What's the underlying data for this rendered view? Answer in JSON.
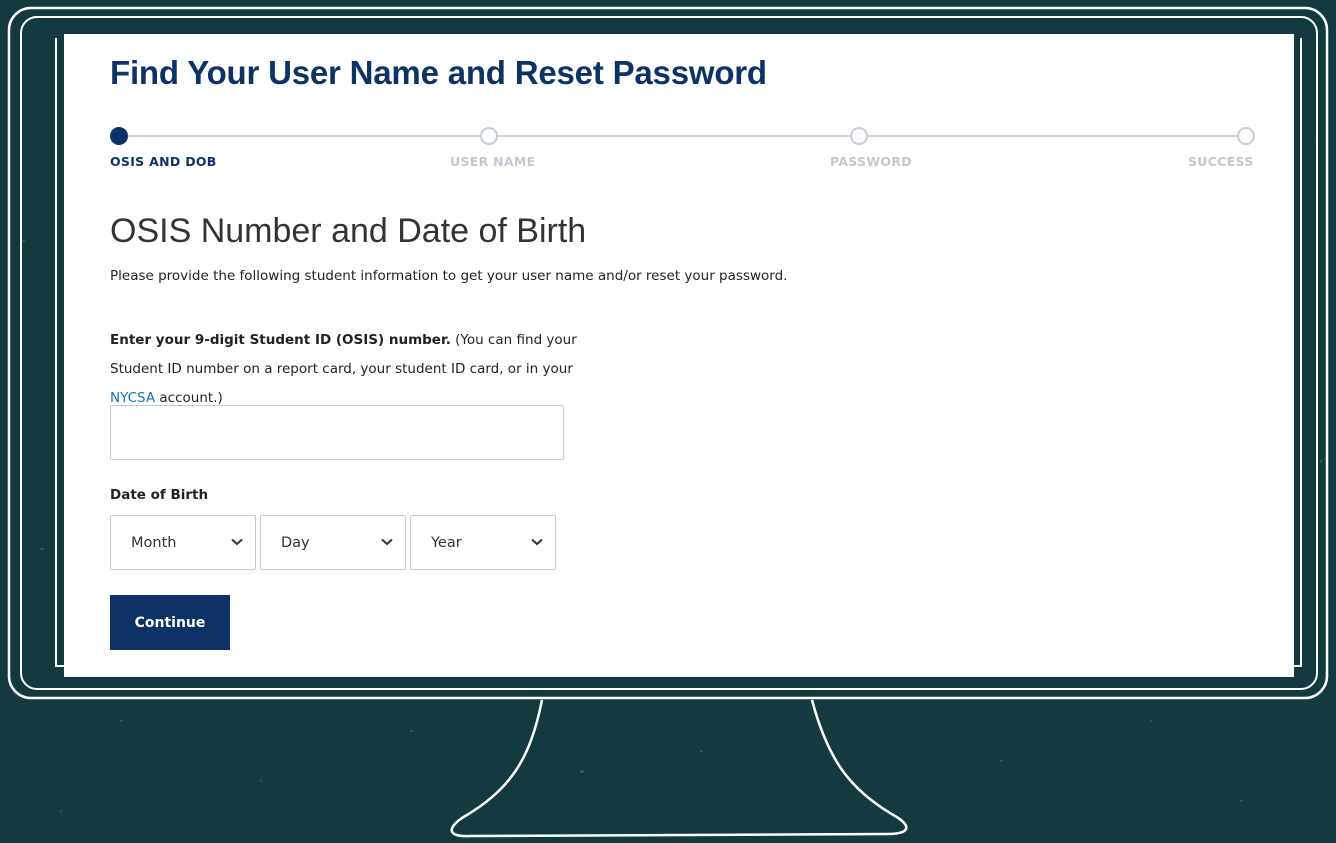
{
  "page": {
    "title": "Find Your User Name and Reset Password"
  },
  "stepper": {
    "steps": [
      {
        "label": "OSIS AND DOB",
        "active": true
      },
      {
        "label": "USER NAME",
        "active": false
      },
      {
        "label": "PASSWORD",
        "active": false
      },
      {
        "label": "SUCCESS",
        "active": false
      }
    ]
  },
  "form": {
    "heading": "OSIS Number and Date of Birth",
    "intro": "Please provide the following student information to get your user name and/or reset your password.",
    "osis_label_bold": "Enter your 9-digit Student ID (OSIS) number.",
    "osis_label_rest": " (You can find your Student ID number on a report card, your student ID card, or in your ",
    "osis_link": "NYCSA",
    "osis_label_end": " account.)",
    "osis_value": "",
    "dob_label": "Date of Birth",
    "month_placeholder": "Month",
    "day_placeholder": "Day",
    "year_placeholder": "Year",
    "continue_label": "Continue"
  },
  "colors": {
    "background": "#133b3f",
    "primary": "#0d3366",
    "link": "#1a6fb0",
    "inactive_step": "#c2c8d0"
  }
}
